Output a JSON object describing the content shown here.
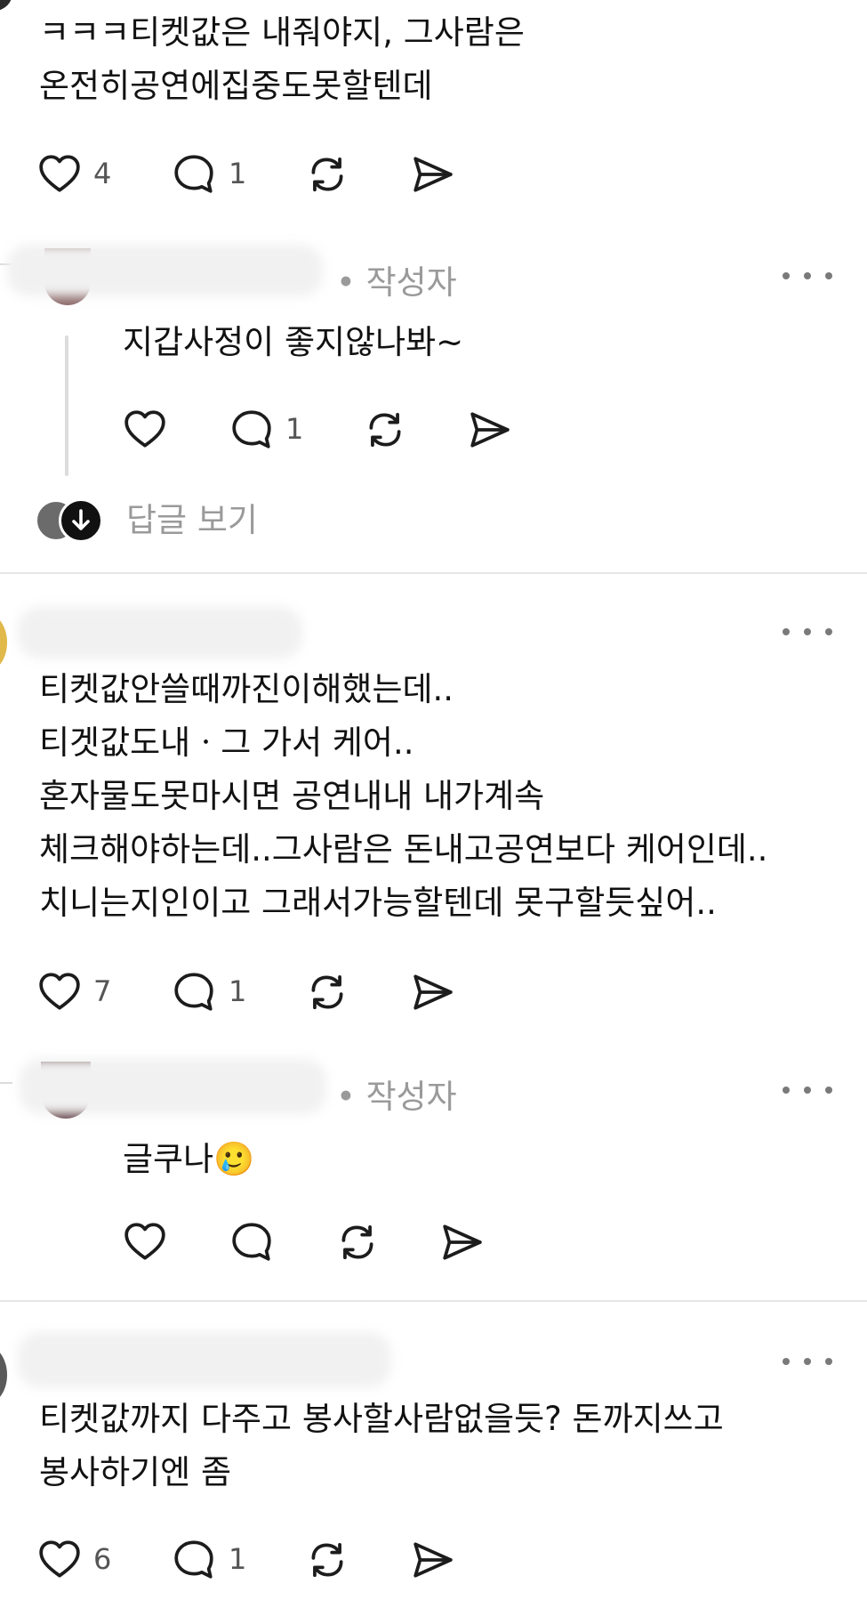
{
  "post1": {
    "lines": [
      "ㅋㅋㅋ티켓값은 내줘야지, 그사람은",
      "온전히공연에집중도못할텐데"
    ],
    "likes": "4",
    "replies": "1"
  },
  "reply1": {
    "author_badge": "• 작성자",
    "text": "지갑사정이 좋지않나봐~",
    "replies": "1",
    "view_replies": "답글 보기"
  },
  "post2": {
    "lines": [
      "티켓값안쓸때까진이해했는데..",
      "티겟값도내ㆍ그 가서 케어..",
      "혼자물도못마시면 공연내내 내가계속",
      "체크해야하는데..그사람은 돈내고공연보다 케어인데..",
      "치니는지인이고 그래서가능할텐데 못구할듯싶어.."
    ],
    "likes": "7",
    "replies": "1"
  },
  "reply2": {
    "author_badge": "• 작성자",
    "text": "글쿠나",
    "emoji": "🥲"
  },
  "post3": {
    "lines": [
      "티켓값까지 다주고 봉사할사람없을듯? 돈까지쓰고",
      "봉사하기엔 좀"
    ],
    "likes": "6",
    "replies": "1"
  },
  "icons": {
    "like": "heart-icon",
    "reply": "comment-bubble-icon",
    "repost": "repost-icon",
    "share": "send-icon",
    "more": "more-dots-icon",
    "expand": "arrow-down-icon"
  },
  "colors": {
    "text": "#111111",
    "muted": "#9a9a9a",
    "divider": "#e6e6e6",
    "thread": "#dcdcdc"
  }
}
